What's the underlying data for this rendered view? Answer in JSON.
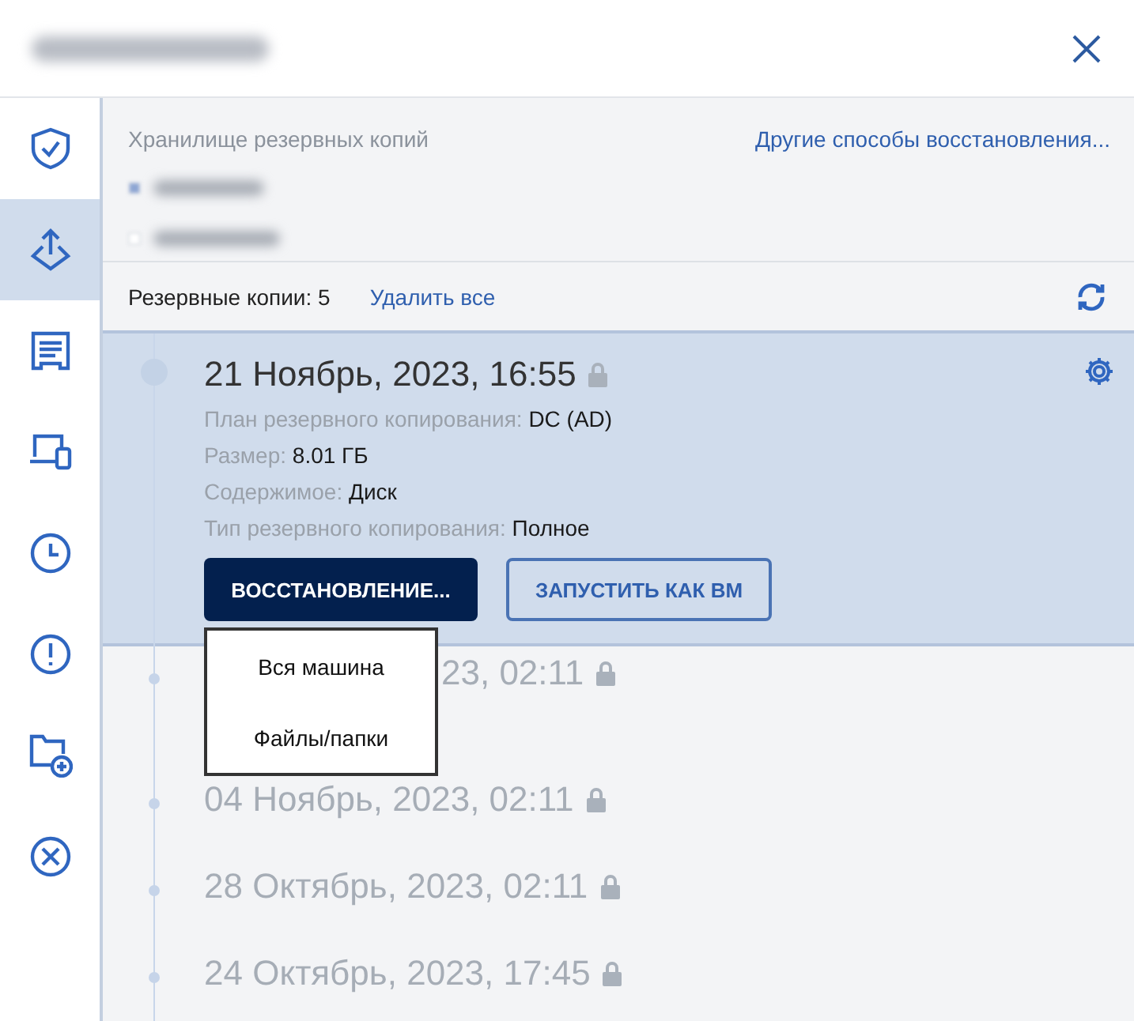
{
  "sidebar": {
    "items": [
      {
        "kind": "shield",
        "selected": false
      },
      {
        "kind": "restore",
        "selected": true
      },
      {
        "kind": "report",
        "selected": false
      },
      {
        "kind": "devices",
        "selected": false
      },
      {
        "kind": "clock",
        "selected": false
      },
      {
        "kind": "alert",
        "selected": false
      },
      {
        "kind": "folder-add",
        "selected": false
      },
      {
        "kind": "cancel",
        "selected": false
      }
    ]
  },
  "storage": {
    "label": "Хранилище резервных копий",
    "other_link": "Другие способы восстановления..."
  },
  "backups": {
    "count_label": "Резервные копии: 5",
    "delete_all": "Удалить все",
    "items": [
      {
        "title": "21 Ноябрь, 2023, 16:55",
        "locked": true,
        "selected": true,
        "kind": "full",
        "details": [
          {
            "label": "План резервного копирования:",
            "value": "DC (AD)"
          },
          {
            "label": "Размер:",
            "value": "8.01 ГБ"
          },
          {
            "label": "Содержимое:",
            "value": "Диск"
          },
          {
            "label": "Тип резервного копирования:",
            "value": "Полное"
          }
        ],
        "actions": [
          {
            "label": "ВОССТАНОВЛЕНИЕ...",
            "kind": "primary"
          },
          {
            "label": "ЗАПУСТИТЬ КАК ВМ",
            "kind": "secondary"
          }
        ]
      },
      {
        "title": "23, 02:11",
        "locked": true,
        "selected": false,
        "kind": "partly-hidden"
      },
      {
        "title": "04 Ноябрь, 2023, 02:11",
        "locked": true,
        "selected": false,
        "kind": "plain"
      },
      {
        "title": "28 Октябрь, 2023, 02:11",
        "locked": true,
        "selected": false,
        "kind": "plain"
      },
      {
        "title": "24 Октябрь, 2023, 17:45",
        "locked": true,
        "selected": false,
        "kind": "plain"
      }
    ]
  },
  "restore_menu": {
    "items": [
      "Вся машина",
      "Файлы/папки"
    ]
  }
}
